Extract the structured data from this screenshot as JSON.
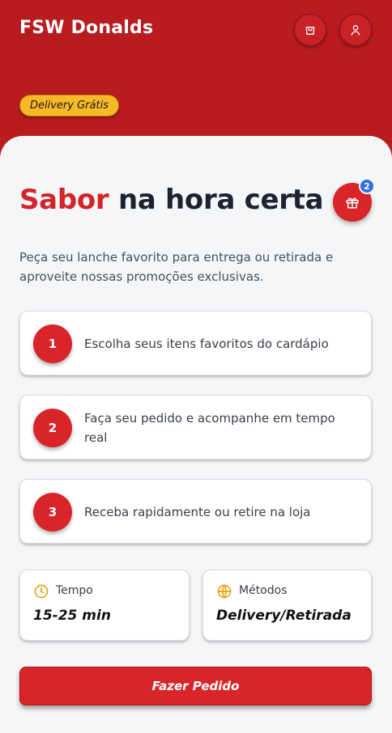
{
  "header": {
    "brand": "FSW Donalds",
    "delivery_badge": "Delivery Grátis",
    "icons": [
      "shopping-bag-icon",
      "user-icon"
    ]
  },
  "hero": {
    "title_accent": "Sabor",
    "title_rest": " na hora certa",
    "gift_count": "2",
    "description": "Peça seu lanche favorito para entrega ou retirada e aproveite nossas promoções exclusivas."
  },
  "steps": [
    {
      "number": "1",
      "text": "Escolha seus itens favoritos do cardápio"
    },
    {
      "number": "2",
      "text": "Faça seu pedido e acompanhe em tempo real"
    },
    {
      "number": "3",
      "text": "Receba rapidamente ou retire na loja"
    }
  ],
  "info": {
    "time_label": "Tempo",
    "time_value": "15-25 min",
    "methods_label": "Métodos",
    "methods_value": "Delivery/Retirada"
  },
  "cta": {
    "label": "Fazer Pedido"
  },
  "colors": {
    "primary": "#d92529",
    "header_bg": "#b81c1f",
    "badge_yellow": "#f7b928",
    "notification_blue": "#2f6fe0",
    "icon_amber": "#e8a317"
  }
}
